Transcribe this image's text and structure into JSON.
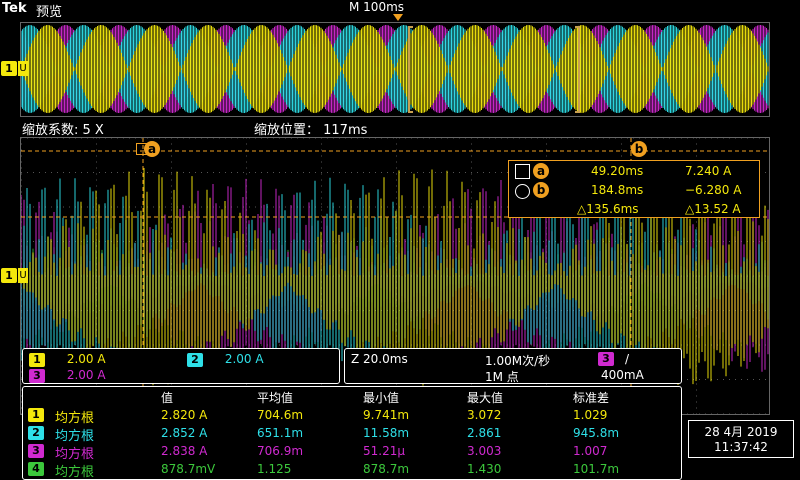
{
  "header": {
    "logo": "Tek",
    "mode": "预览",
    "timebase": "M 100ms"
  },
  "zoom": {
    "factor_label": "缩放系数: 5 X",
    "position_label": "缩放位置： 117ms"
  },
  "cursors": {
    "a_tag": "a",
    "b_tag": "b",
    "a_time": "49.20ms",
    "a_value": "7.240 A",
    "b_time": "184.8ms",
    "b_value": "−6.280 A",
    "delta_time": "△135.6ms",
    "delta_value": "△13.52 A"
  },
  "channels": [
    {
      "num": "1",
      "scale": "2.00 A",
      "color": "#f4e80c"
    },
    {
      "num": "2",
      "scale": "2.00 A",
      "color": "#2ee0e8"
    },
    {
      "num": "3",
      "scale": "2.00 A",
      "color": "#d02ad0"
    }
  ],
  "acquisition": {
    "zoom_time": "Z 20.0ms",
    "rate": "1.00M次/秒",
    "points": "1M 点",
    "trigger_channel": "3",
    "trigger_slope": "/",
    "trigger_level": "400mA"
  },
  "measurements": {
    "headers": [
      "值",
      "平均值",
      "最小值",
      "最大值",
      "标准差"
    ],
    "rows": [
      {
        "ch": "1",
        "type": "均方根",
        "color": "#f4e80c",
        "values": [
          "2.820 A",
          "704.6m",
          "9.741m",
          "3.072",
          "1.029"
        ]
      },
      {
        "ch": "2",
        "type": "均方根",
        "color": "#2ee0e8",
        "values": [
          "2.852 A",
          "651.1m",
          "11.58m",
          "2.861",
          "945.8m"
        ]
      },
      {
        "ch": "3",
        "type": "均方根",
        "color": "#d02ad0",
        "values": [
          "2.838 A",
          "706.9m",
          "51.21μ",
          "3.003",
          "1.007"
        ]
      },
      {
        "ch": "4",
        "type": "均方根",
        "color": "#3cc83c",
        "values": [
          "878.7mV",
          "1.125",
          "878.7m",
          "1.430",
          "101.7m"
        ]
      }
    ]
  },
  "datetime": {
    "date": "28 4月 2019",
    "time": "11:37:42"
  },
  "ground_marker": {
    "ch": "1",
    "sym": "U"
  }
}
